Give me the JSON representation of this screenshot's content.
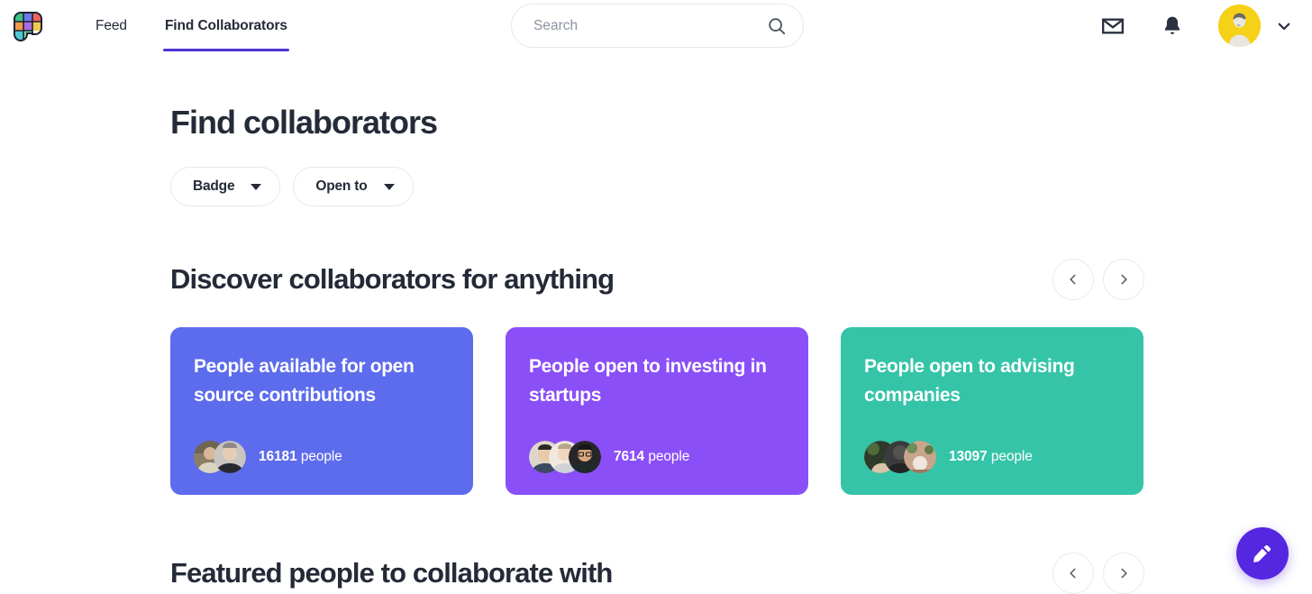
{
  "header": {
    "logo_name": "grid-logo",
    "logo_colors": [
      "#3fc08b",
      "#6b79e8",
      "#f0625f",
      "#f2994a",
      "#a86ce0",
      "#f2c94c",
      "#4ec9d6",
      "#7fd6a8"
    ],
    "tabs": [
      {
        "label": "Feed",
        "active": false
      },
      {
        "label": "Find Collaborators",
        "active": true
      }
    ],
    "search": {
      "placeholder": "Search",
      "value": ""
    },
    "mail_icon": "mail-icon",
    "notification_icon": "bell-icon",
    "avatar_alt": "user-avatar",
    "avatar_bg": "#f5d117",
    "chevron_icon": "chevron-down-icon",
    "active_tab_color": "#4f33d6"
  },
  "page": {
    "title": "Find collaborators",
    "filters": [
      {
        "label": "Badge"
      },
      {
        "label": "Open to"
      }
    ]
  },
  "discover": {
    "title": "Discover collaborators for anything",
    "prev_label": "Previous",
    "next_label": "Next",
    "cards": [
      {
        "title": "People available for open source contributions",
        "count": "16181",
        "count_suffix": "people",
        "color": "#5d6cec",
        "avatars": 2
      },
      {
        "title": "People open to investing in startups",
        "count": "7614",
        "count_suffix": "people",
        "color": "#8b4ff7",
        "avatars": 3
      },
      {
        "title": "People open to advising companies",
        "count": "13097",
        "count_suffix": "people",
        "color": "#35c4a8",
        "avatars": 3
      }
    ]
  },
  "featured": {
    "title": "Featured people to collaborate with",
    "prev_label": "Previous",
    "next_label": "Next"
  },
  "fab": {
    "label": "Compose",
    "icon": "pencil-icon",
    "color": "#5627e0"
  }
}
